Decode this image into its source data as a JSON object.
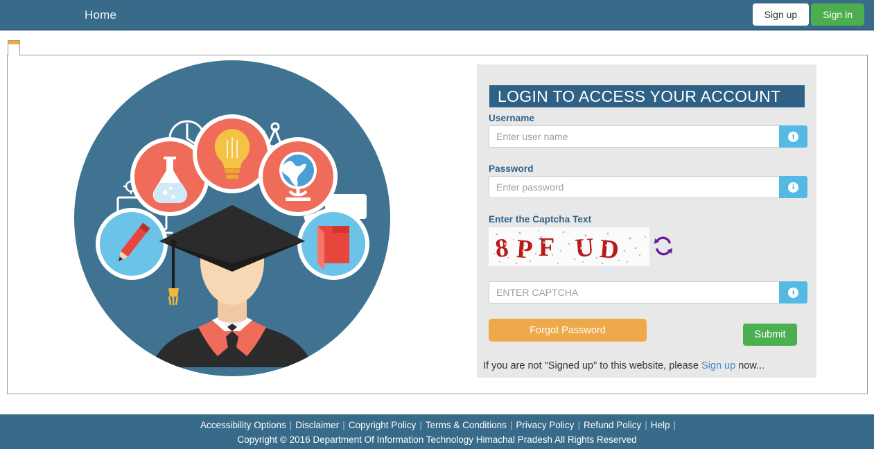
{
  "navbar": {
    "home_label": "Home",
    "signup_label": "Sign up",
    "signin_label": "Sign in",
    "bg_color": "#386a8a"
  },
  "login": {
    "title": "LOGIN TO ACCESS YOUR ACCOUNT",
    "username_label": "Username",
    "username_placeholder": "Enter user name",
    "username_value": "",
    "password_label": "Password",
    "password_placeholder": "Enter password",
    "password_value": "",
    "captcha_label": "Enter the Captcha Text",
    "captcha_text": "8PF UD",
    "captcha_input_placeholder": "ENTER CAPTCHA",
    "captcha_input_value": "",
    "refresh_icon": "refresh-icon",
    "info_icon": "info-icon",
    "forgot_label": "Forgot Password",
    "submit_label": "Submit",
    "signup_note_pre": "If you are not \"Signed up\" to this website, please ",
    "signup_note_link": "Sign up",
    "signup_note_post": " now...",
    "title_bg": "#2f6187",
    "panel_bg": "#e8e8e8",
    "forgot_color": "#eea94a",
    "submit_color": "#4cb050",
    "captcha_color": "#b71c1c",
    "refresh_color": "#6a1b9a"
  },
  "illustration": {
    "name": "graduate-student-education-illustration",
    "circle_color": "#3f7391",
    "icons": [
      "clock",
      "pie-chart",
      "flask",
      "lightbulb",
      "compass",
      "globe",
      "laptop",
      "pencil",
      "book",
      "speech-bubble",
      "paper-plane"
    ]
  },
  "footer": {
    "links": [
      "Accessibility Options",
      "Disclaimer",
      "Copyright Policy",
      "Terms & Conditions",
      "Privacy Policy",
      "Refund Policy",
      "Help"
    ],
    "copyright": "Copyright © 2016 Department Of Information Technology Himachal Pradesh All Rights Reserved",
    "bg_color": "#386a8a"
  }
}
